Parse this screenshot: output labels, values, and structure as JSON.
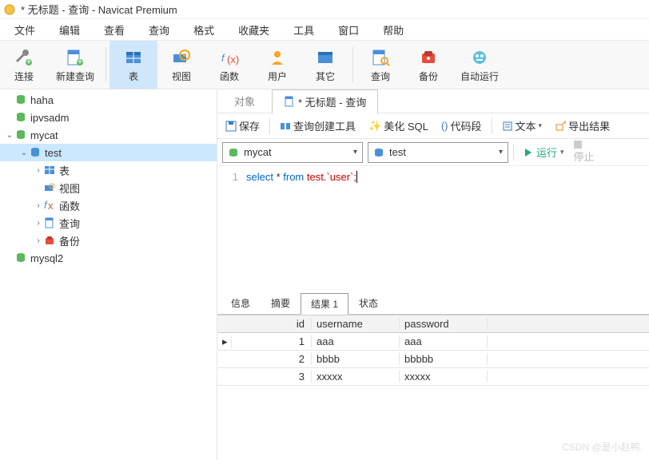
{
  "title": "* 无标题 - 查询 - Navicat Premium",
  "menubar": [
    "文件",
    "编辑",
    "查看",
    "查询",
    "格式",
    "收藏夹",
    "工具",
    "窗口",
    "帮助"
  ],
  "toolbar": [
    {
      "label": "连接",
      "name": "connect"
    },
    {
      "label": "新建查询",
      "name": "new-query"
    },
    {
      "label": "表",
      "name": "tables",
      "active": true
    },
    {
      "label": "视图",
      "name": "views"
    },
    {
      "label": "函数",
      "name": "functions"
    },
    {
      "label": "用户",
      "name": "users"
    },
    {
      "label": "其它",
      "name": "others"
    },
    {
      "label": "查询",
      "name": "query"
    },
    {
      "label": "备份",
      "name": "backup"
    },
    {
      "label": "自动运行",
      "name": "automation"
    }
  ],
  "sidebar": {
    "items": [
      {
        "label": "haha",
        "indent": 0,
        "arrow": "",
        "icon": "db-green"
      },
      {
        "label": "ipvsadm",
        "indent": 0,
        "arrow": "",
        "icon": "db-green"
      },
      {
        "label": "mycat",
        "indent": 0,
        "arrow": "open",
        "icon": "db-green"
      },
      {
        "label": "test",
        "indent": 1,
        "arrow": "open",
        "icon": "schema",
        "selected": true
      },
      {
        "label": "表",
        "indent": 2,
        "arrow": "closed",
        "icon": "table"
      },
      {
        "label": "视图",
        "indent": 2,
        "arrow": "",
        "icon": "view"
      },
      {
        "label": "函数",
        "indent": 2,
        "arrow": "closed",
        "icon": "fx"
      },
      {
        "label": "查询",
        "indent": 2,
        "arrow": "closed",
        "icon": "query"
      },
      {
        "label": "备份",
        "indent": 2,
        "arrow": "closed",
        "icon": "backup"
      },
      {
        "label": "mysql2",
        "indent": 0,
        "arrow": "",
        "icon": "db-green"
      }
    ]
  },
  "tabs": [
    {
      "label": "对象",
      "active": false
    },
    {
      "label": "* 无标题 - 查询",
      "active": true
    }
  ],
  "subtoolbar": {
    "save": "保存",
    "builder": "查询创建工具",
    "beautify": "美化 SQL",
    "snippet": "代码段",
    "text": "文本",
    "export": "导出结果"
  },
  "dropdowns": {
    "connection": "mycat",
    "database": "test",
    "run": "运行",
    "stop": "停止"
  },
  "editor": {
    "line": "1",
    "sql_kw": "select",
    "sql_rest": " * ",
    "sql_from": "from",
    "sql_tail": " test.`user`;"
  },
  "result_tabs": [
    "信息",
    "摘要",
    "结果 1",
    "状态"
  ],
  "result_active": 2,
  "grid": {
    "columns": [
      "id",
      "username",
      "password"
    ],
    "rows": [
      {
        "id": "1",
        "username": "aaa",
        "password": "aaa",
        "current": true
      },
      {
        "id": "2",
        "username": "bbbb",
        "password": "bbbbb",
        "current": false
      },
      {
        "id": "3",
        "username": "xxxxx",
        "password": "xxxxx",
        "current": false
      }
    ]
  },
  "watermark": "CSDN @是小赵鸭."
}
